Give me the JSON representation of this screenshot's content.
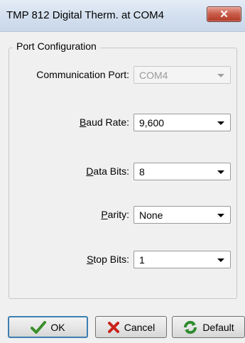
{
  "window": {
    "title": "TMP 812 Digital Therm. at COM4",
    "close_label": "✕"
  },
  "group": {
    "title": "Port Configuration"
  },
  "fields": {
    "port": {
      "label": "Communication Port:",
      "value": "COM4"
    },
    "baud": {
      "label_mnemonic": "B",
      "label_rest": "aud Rate:",
      "value": "9,600"
    },
    "data": {
      "label_mnemonic": "D",
      "label_rest": "ata Bits:",
      "value": "8"
    },
    "parity": {
      "label_mnemonic": "P",
      "label_rest": "arity:",
      "value": "None"
    },
    "stop": {
      "label_mnemonic": "S",
      "label_rest": "top Bits:",
      "value": "1"
    }
  },
  "buttons": {
    "ok": "OK",
    "cancel": "Cancel",
    "default": "Default"
  },
  "colors": {
    "ok_check": "#3a8f2a",
    "cancel_x": "#c8221a",
    "default_refresh": "#2e8b2e"
  }
}
